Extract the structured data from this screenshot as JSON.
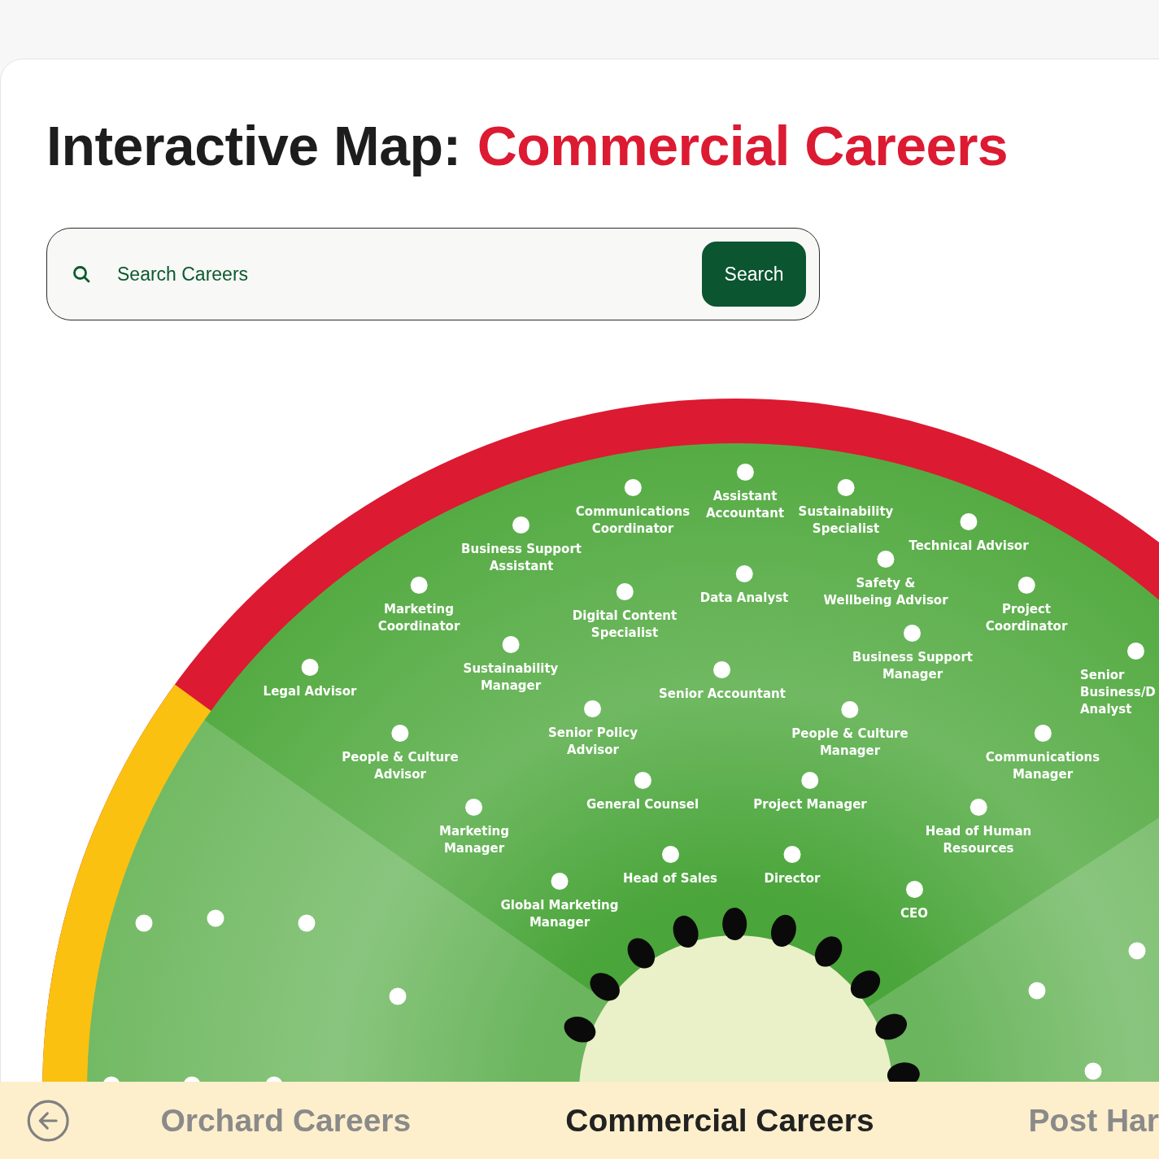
{
  "title": {
    "prefix": "Interactive Map:",
    "highlight": "Commercial Careers"
  },
  "search": {
    "placeholder": "Search Careers",
    "button": "Search"
  },
  "careers": [
    {
      "label": [
        "Communications",
        "Coordinator"
      ]
    },
    {
      "label": [
        "Assistant",
        "Accountant"
      ]
    },
    {
      "label": [
        "Sustainability",
        "Specialist"
      ]
    },
    {
      "label": [
        "Business Support",
        "Assistant"
      ]
    },
    {
      "label": [
        "Technical Advisor"
      ]
    },
    {
      "label": [
        "Data Analyst"
      ]
    },
    {
      "label": [
        "Safety &",
        "Wellbeing Advisor"
      ]
    },
    {
      "label": [
        "Marketing",
        "Coordinator"
      ]
    },
    {
      "label": [
        "Digital Content",
        "Specialist"
      ]
    },
    {
      "label": [
        "Project",
        "Coordinator"
      ]
    },
    {
      "label": [
        "Business Support",
        "Manager"
      ]
    },
    {
      "label": [
        "Sustainability",
        "Manager"
      ]
    },
    {
      "label": [
        "Legal Advisor"
      ]
    },
    {
      "label": [
        "Senior Accountant"
      ]
    },
    {
      "label": [
        "Senior",
        "Business/D",
        "Analyst"
      ]
    },
    {
      "label": [
        "People & Culture",
        "Advisor"
      ]
    },
    {
      "label": [
        "Senior Policy",
        "Advisor"
      ]
    },
    {
      "label": [
        "People & Culture",
        "Manager"
      ]
    },
    {
      "label": [
        "Communications",
        "Manager"
      ]
    },
    {
      "label": [
        "General Counsel"
      ]
    },
    {
      "label": [
        "Project Manager"
      ]
    },
    {
      "label": [
        "Marketing",
        "Manager"
      ]
    },
    {
      "label": [
        "Head of Human",
        "Resources"
      ]
    },
    {
      "label": [
        "Head of Sales"
      ]
    },
    {
      "label": [
        "Director"
      ]
    },
    {
      "label": [
        "Global Marketing",
        "Manager"
      ]
    },
    {
      "label": [
        "CEO"
      ]
    }
  ],
  "nav": {
    "tabs": [
      {
        "label": "Orchard Careers",
        "selected": false
      },
      {
        "label": "Commercial Careers",
        "selected": true
      },
      {
        "label": "Post Har",
        "selected": false
      }
    ]
  }
}
